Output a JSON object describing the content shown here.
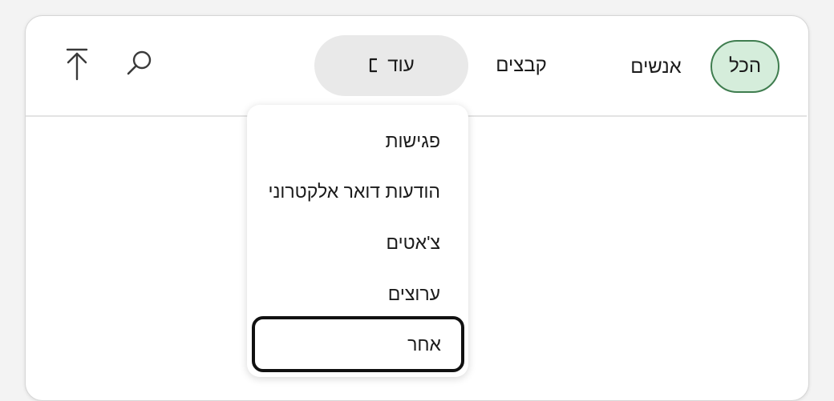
{
  "filters": {
    "all_label": "הכל",
    "people_label": "אנשים",
    "files_label": "קבצים",
    "more_label": "עוד"
  },
  "toolbar": {
    "search_icon": "search-icon",
    "scroll_top_icon": "arrow-up-to-top-icon"
  },
  "more_menu": {
    "items": [
      {
        "label": "פגישות"
      },
      {
        "label": "הודעות דואר אלקטרוני"
      },
      {
        "label": "צ'אטים"
      },
      {
        "label": "ערוצים"
      },
      {
        "label": "אחר"
      }
    ]
  },
  "colors": {
    "selected_pill_bg": "#d5eddb",
    "selected_pill_border": "#3f7d4f",
    "more_pill_bg": "#e9e9e9",
    "focus_ring": "#111111"
  }
}
